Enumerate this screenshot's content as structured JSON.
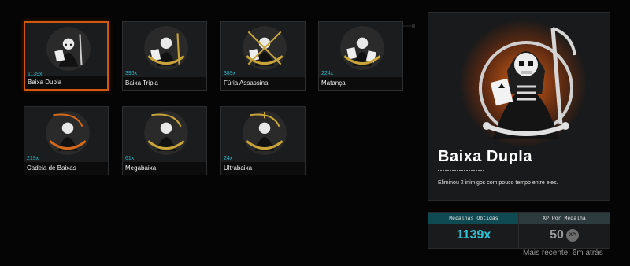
{
  "medals": [
    {
      "name": "Baixa Dupla",
      "count": "1139x",
      "icon": "reaper-double-icon",
      "selected": true,
      "accent": "#bdbdbd"
    },
    {
      "name": "Baixa Tripla",
      "count": "396x",
      "icon": "reaper-triple-icon",
      "selected": false,
      "accent": "#c9a43a"
    },
    {
      "name": "Fúria Assassina",
      "count": "389x",
      "icon": "reaper-fury-icon",
      "selected": false,
      "accent": "#c9a43a"
    },
    {
      "name": "Matança",
      "count": "224x",
      "icon": "reaper-slaughter-icon",
      "selected": false,
      "accent": "#c9a43a"
    },
    {
      "name": "Cadeia de Baixas",
      "count": "219x",
      "icon": "reaper-chain-icon",
      "selected": false,
      "accent": "#d4691c"
    },
    {
      "name": "Megabaixa",
      "count": "61x",
      "icon": "reaper-mega-icon",
      "selected": false,
      "accent": "#c9a43a"
    },
    {
      "name": "Ultrabaixa",
      "count": "24x",
      "icon": "reaper-ultra-icon",
      "selected": false,
      "accent": "#c9a43a"
    }
  ],
  "detail": {
    "title": "Baixa Dupla",
    "description": "Eliminou 2 inimigos com pouco tempo entre eles.",
    "icon": "reaper-double-large-icon",
    "medals_label": "Medalhas Obtidas",
    "medals_value": "1139x",
    "xp_label": "XP Por Medalha",
    "xp_value": "50",
    "xp_badge": "XP",
    "recent": "Mais recente: 6m atrás"
  },
  "colors": {
    "accent_orange": "#d4570f",
    "accent_teal": "#35c1d4"
  }
}
